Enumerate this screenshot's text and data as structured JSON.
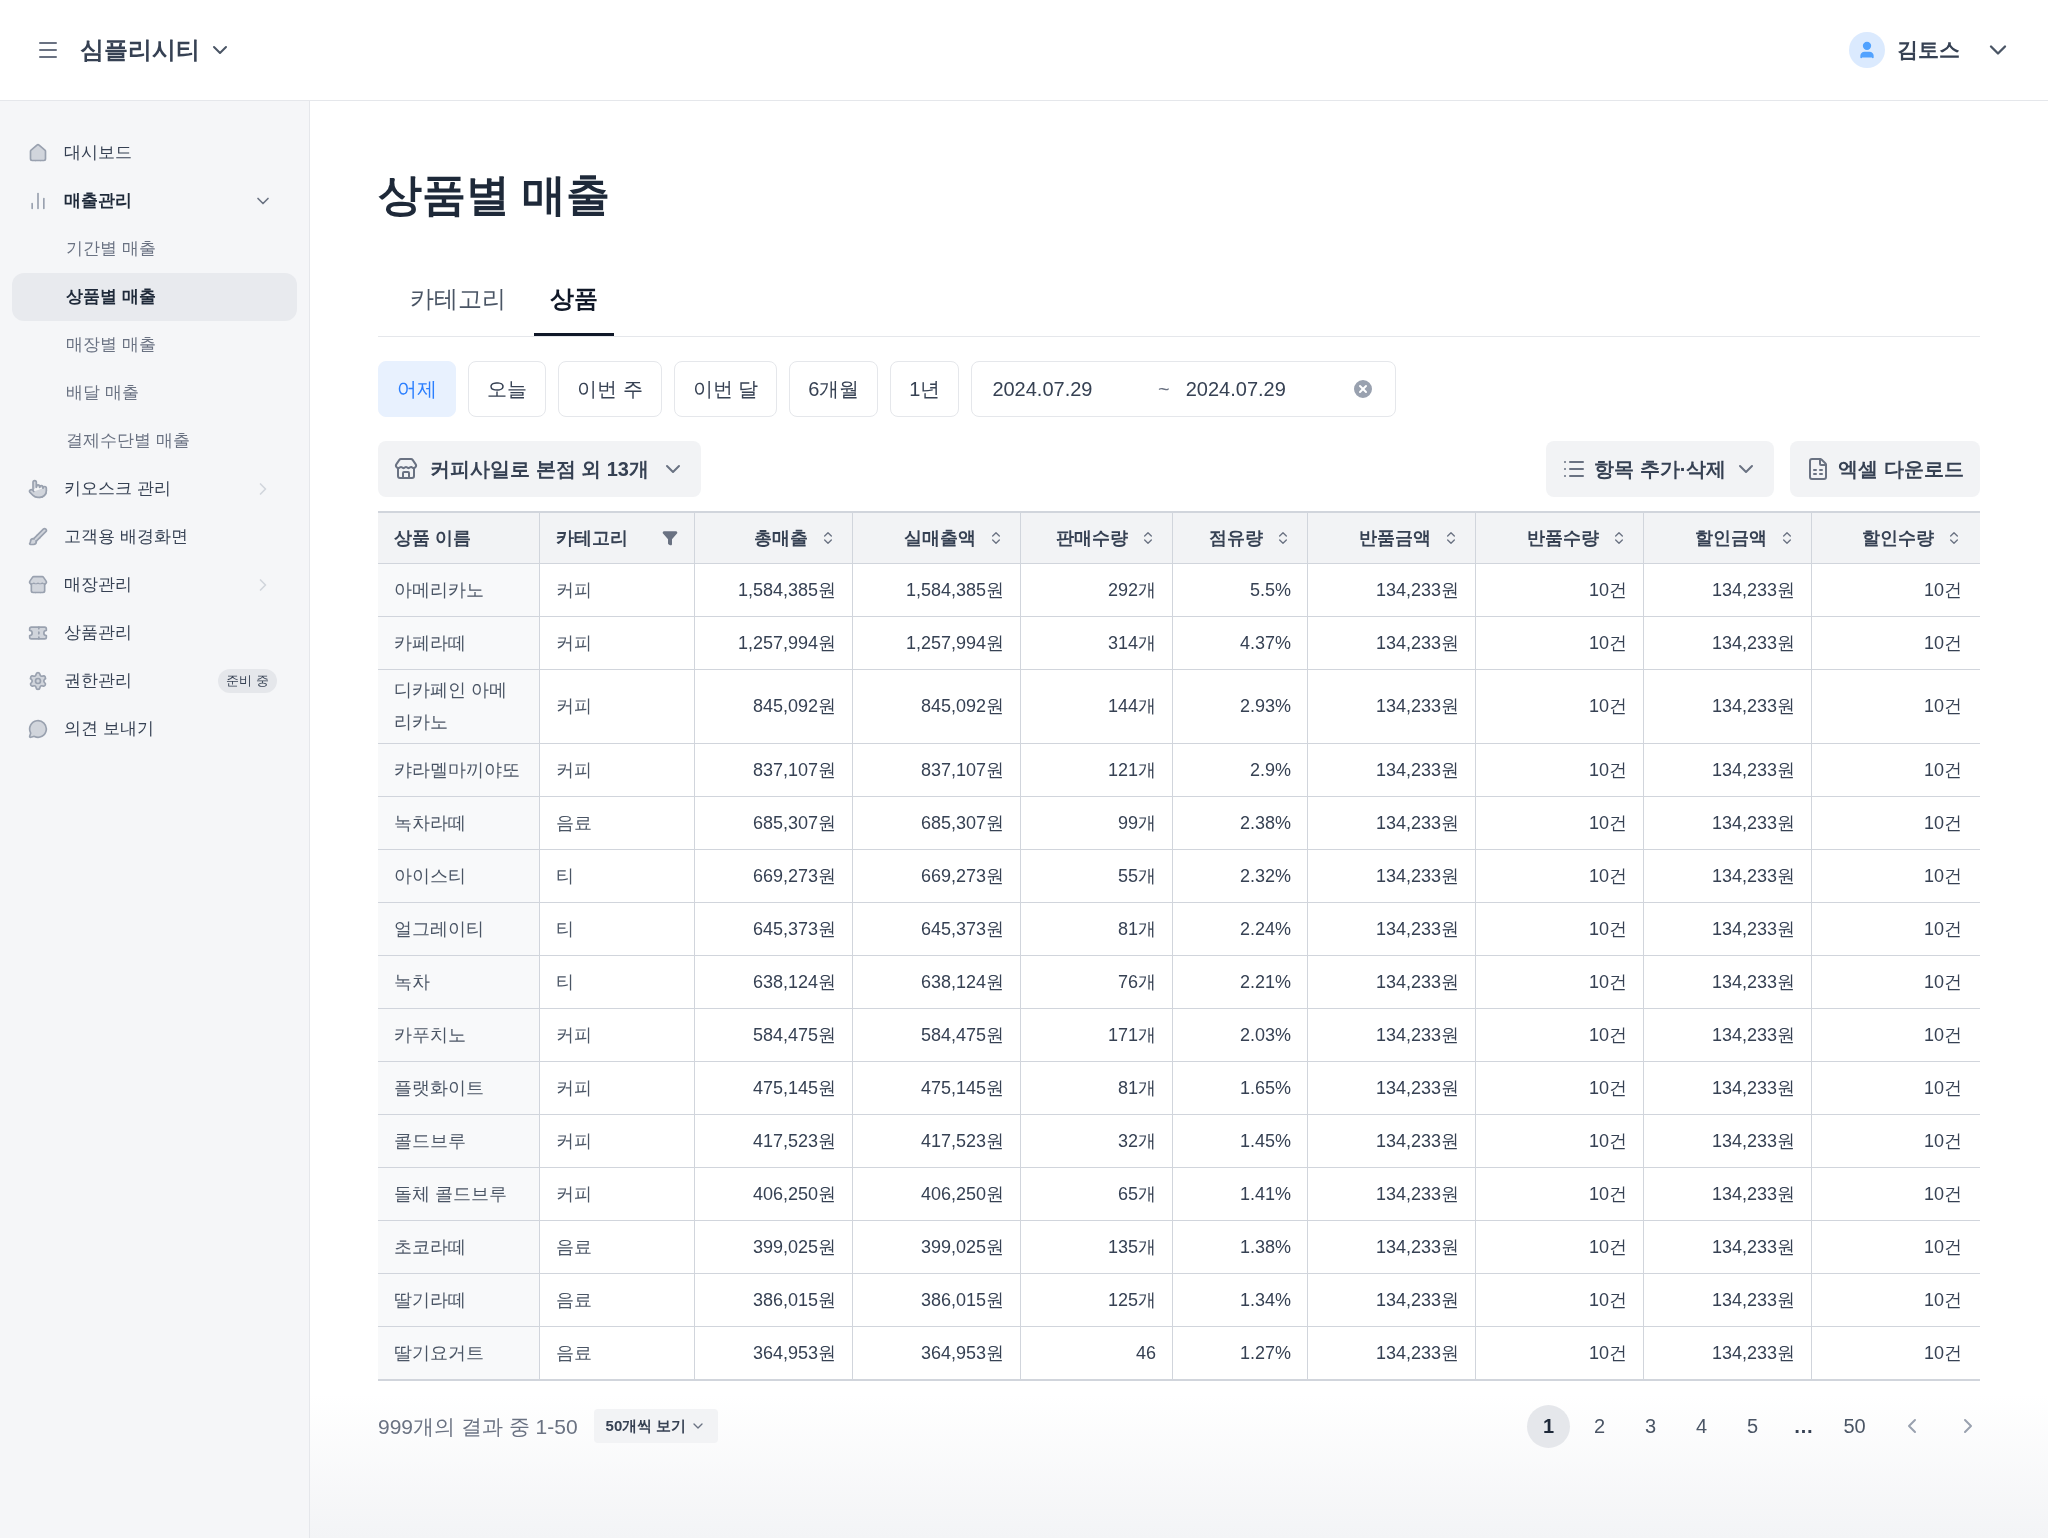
{
  "header": {
    "brand": "심플리시티",
    "user": "김토스"
  },
  "sidebar": {
    "items": [
      {
        "label": "대시보드",
        "selected": false
      },
      {
        "label": "매출관리",
        "selected": false,
        "expanded": true,
        "children": [
          {
            "label": "기간별 매출",
            "selected": false
          },
          {
            "label": "상품별 매출",
            "selected": true
          },
          {
            "label": "매장별 매출",
            "selected": false
          },
          {
            "label": "배달 매출",
            "selected": false
          },
          {
            "label": "결제수단별 매출",
            "selected": false
          }
        ]
      },
      {
        "label": "키오스크 관리",
        "selected": false,
        "expanded": false
      },
      {
        "label": "고객용 배경화면",
        "selected": false
      },
      {
        "label": "매장관리",
        "selected": false,
        "expanded": false
      },
      {
        "label": "상품관리",
        "selected": false
      },
      {
        "label": "권한관리",
        "selected": false,
        "badge": "준비 중"
      },
      {
        "label": "의견 보내기",
        "selected": false
      }
    ]
  },
  "page_title": "상품별 매출",
  "tabs": [
    {
      "label": "카테고리",
      "selected": false
    },
    {
      "label": "상품",
      "selected": true
    }
  ],
  "date_presets": [
    {
      "label": "어제",
      "selected": true
    },
    {
      "label": "오늘",
      "selected": false
    },
    {
      "label": "이번 주",
      "selected": false
    },
    {
      "label": "이번 달",
      "selected": false
    },
    {
      "label": "6개월",
      "selected": false
    },
    {
      "label": "1년",
      "selected": false
    }
  ],
  "date_range": {
    "start": "2024.07.29",
    "separator": "~",
    "end": "2024.07.29"
  },
  "store_filter": "커피사일로 본점 외 13개",
  "column_button": "항목 추가·삭제",
  "excel_button": "엑셀 다운로드",
  "table": {
    "columns": [
      {
        "label": "상품 이름",
        "kind": "plain"
      },
      {
        "label": "카테고리",
        "kind": "filter"
      },
      {
        "label": "총매출",
        "kind": "sort"
      },
      {
        "label": "실매출액",
        "kind": "sort"
      },
      {
        "label": "판매수량",
        "kind": "sort"
      },
      {
        "label": "점유량",
        "kind": "sort"
      },
      {
        "label": "반품금액",
        "kind": "sort"
      },
      {
        "label": "반품수량",
        "kind": "sort"
      },
      {
        "label": "할인금액",
        "kind": "sort"
      },
      {
        "label": "할인수량",
        "kind": "sort"
      }
    ],
    "rows": [
      [
        "아메리카노",
        "커피",
        "1,584,385원",
        "1,584,385원",
        "292개",
        "5.5%",
        "134,233원",
        "10건",
        "134,233원",
        "10건"
      ],
      [
        "카페라떼",
        "커피",
        "1,257,994원",
        "1,257,994원",
        "314개",
        "4.37%",
        "134,233원",
        "10건",
        "134,233원",
        "10건"
      ],
      [
        "디카페인 아메리카노",
        "커피",
        "845,092원",
        "845,092원",
        "144개",
        "2.93%",
        "134,233원",
        "10건",
        "134,233원",
        "10건"
      ],
      [
        "캬라멜마끼야또",
        "커피",
        "837,107원",
        "837,107원",
        "121개",
        "2.9%",
        "134,233원",
        "10건",
        "134,233원",
        "10건"
      ],
      [
        "녹차라떼",
        "음료",
        "685,307원",
        "685,307원",
        "99개",
        "2.38%",
        "134,233원",
        "10건",
        "134,233원",
        "10건"
      ],
      [
        "아이스티",
        "티",
        "669,273원",
        "669,273원",
        "55개",
        "2.32%",
        "134,233원",
        "10건",
        "134,233원",
        "10건"
      ],
      [
        "얼그레이티",
        "티",
        "645,373원",
        "645,373원",
        "81개",
        "2.24%",
        "134,233원",
        "10건",
        "134,233원",
        "10건"
      ],
      [
        "녹차",
        "티",
        "638,124원",
        "638,124원",
        "76개",
        "2.21%",
        "134,233원",
        "10건",
        "134,233원",
        "10건"
      ],
      [
        "카푸치노",
        "커피",
        "584,475원",
        "584,475원",
        "171개",
        "2.03%",
        "134,233원",
        "10건",
        "134,233원",
        "10건"
      ],
      [
        "플랫화이트",
        "커피",
        "475,145원",
        "475,145원",
        "81개",
        "1.65%",
        "134,233원",
        "10건",
        "134,233원",
        "10건"
      ],
      [
        "콜드브루",
        "커피",
        "417,523원",
        "417,523원",
        "32개",
        "1.45%",
        "134,233원",
        "10건",
        "134,233원",
        "10건"
      ],
      [
        "돌체 콜드브루",
        "커피",
        "406,250원",
        "406,250원",
        "65개",
        "1.41%",
        "134,233원",
        "10건",
        "134,233원",
        "10건"
      ],
      [
        "초코라떼",
        "음료",
        "399,025원",
        "399,025원",
        "135개",
        "1.38%",
        "134,233원",
        "10건",
        "134,233원",
        "10건"
      ],
      [
        "딸기라떼",
        "음료",
        "386,015원",
        "386,015원",
        "125개",
        "1.34%",
        "134,233원",
        "10건",
        "134,233원",
        "10건"
      ],
      [
        "딸기요거트",
        "음료",
        "364,953원",
        "364,953원",
        "46",
        "1.27%",
        "134,233원",
        "10건",
        "134,233원",
        "10건"
      ]
    ]
  },
  "footer": {
    "summary": "999개의 결과 중 1-50",
    "page_size": "50개씩 보기"
  },
  "pagination": {
    "pages": [
      {
        "label": "1",
        "selected": true
      },
      {
        "label": "2",
        "selected": false
      },
      {
        "label": "3",
        "selected": false
      },
      {
        "label": "4",
        "selected": false
      },
      {
        "label": "5",
        "selected": false
      },
      {
        "label": "…",
        "kind": "ellipsis",
        "selected": false
      },
      {
        "label": "50",
        "selected": false
      }
    ]
  }
}
